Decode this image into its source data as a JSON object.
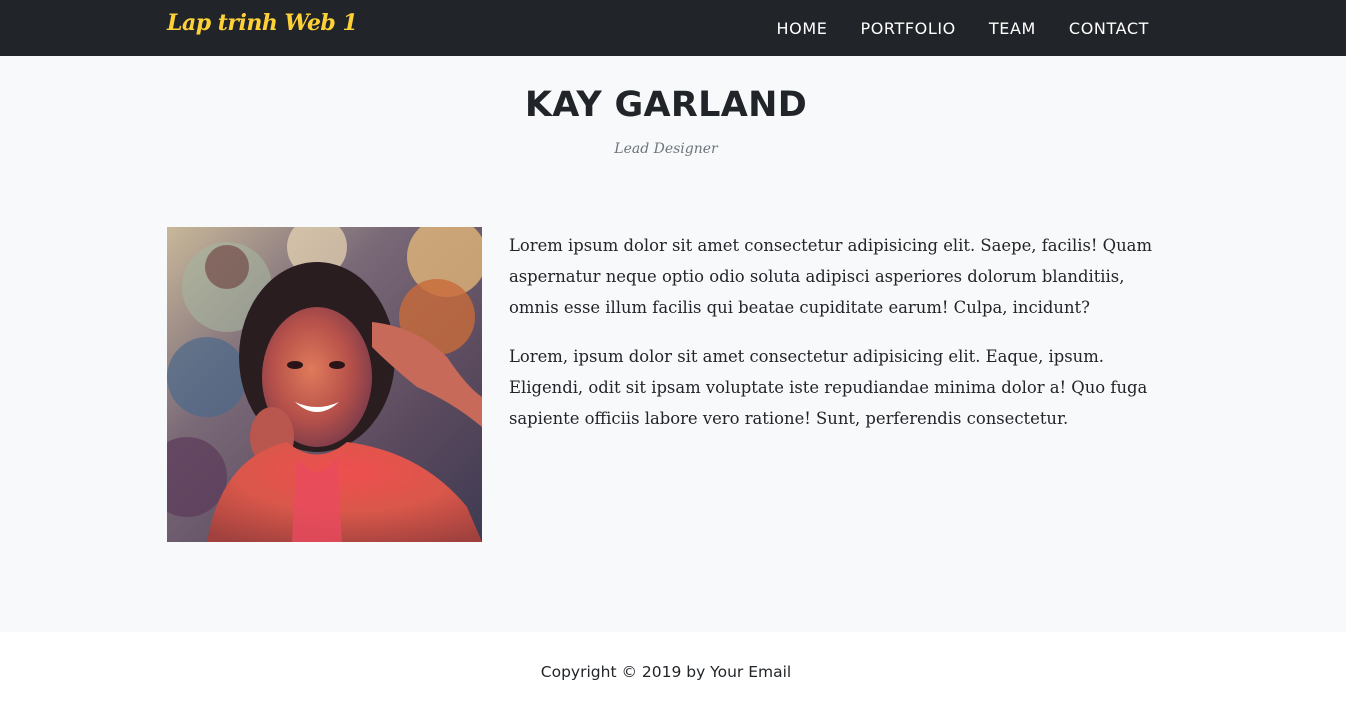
{
  "brand": "Lap trinh Web 1",
  "nav": [
    {
      "label": "HOME"
    },
    {
      "label": "PORTFOLIO"
    },
    {
      "label": "TEAM"
    },
    {
      "label": "CONTACT"
    }
  ],
  "profile": {
    "name": "KAY GARLAND",
    "role": "Lead Designer",
    "photo": "portrait of smiling woman with colorful powder",
    "paragraphs": [
      "Lorem ipsum dolor sit amet consectetur adipisicing elit. Saepe, facilis! Quam aspernatur neque optio odio soluta adipisci asperiores dolorum blanditiis, omnis esse illum facilis qui beatae cupiditate earum! Culpa, incidunt?",
      "Lorem, ipsum dolor sit amet consectetur adipisicing elit. Eaque, ipsum. Eligendi, odit sit ipsam voluptate iste repudiandae minima dolor a! Quo fuga sapiente officiis labore vero ratione! Sunt, perferendis consectetur."
    ]
  },
  "footer": {
    "copyright": "Copyright © 2019 by Your Email"
  },
  "colors": {
    "navbar_bg": "#212529",
    "brand": "#fed136",
    "section_bg": "#f8f9fa",
    "muted": "#6c757d"
  }
}
